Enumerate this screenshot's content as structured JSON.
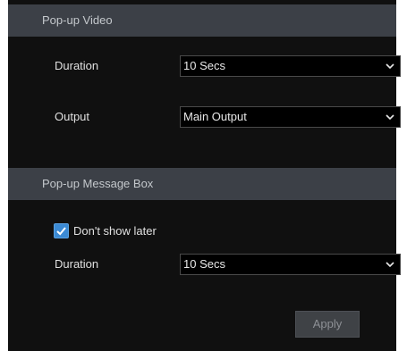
{
  "popup_video": {
    "header": "Pop-up Video",
    "duration_label": "Duration",
    "duration_value": "10 Secs",
    "output_label": "Output",
    "output_value": "Main Output"
  },
  "popup_message_box": {
    "header": "Pop-up Message Box",
    "dont_show_label": "Don't show later",
    "dont_show_checked": true,
    "duration_label": "Duration",
    "duration_value": "10 Secs"
  },
  "actions": {
    "apply_label": "Apply"
  },
  "colors": {
    "panel_background": "#101010",
    "header_background": "#3c4047",
    "checkbox_accent": "#3b8ad4",
    "button_background": "#3f4246"
  }
}
